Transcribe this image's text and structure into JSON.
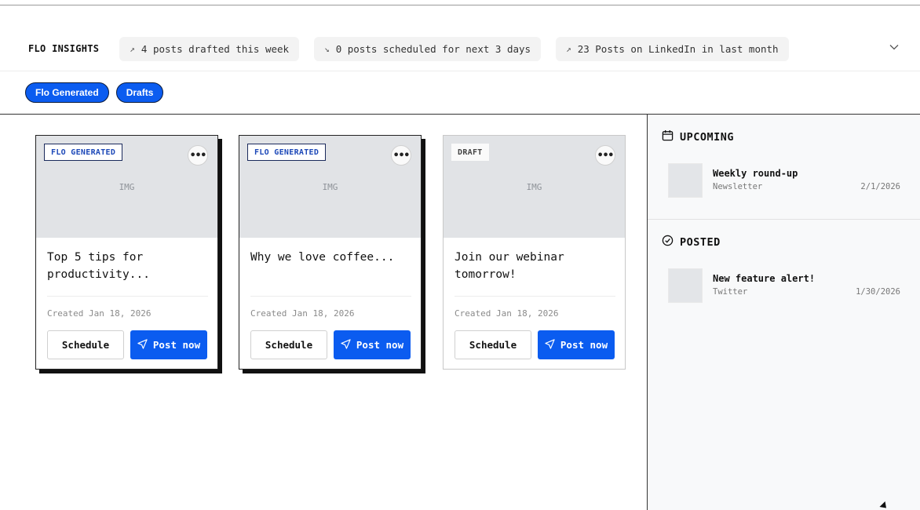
{
  "insights": {
    "title": "FLO INSIGHTS",
    "pills": [
      {
        "trend_icon": "trend-up-icon",
        "text": "4 posts drafted this week"
      },
      {
        "trend_icon": "trend-down-icon",
        "text": "0 posts scheduled for next 3 days"
      },
      {
        "trend_icon": "trend-up-icon",
        "text": "23 Posts on LinkedIn in last month"
      }
    ]
  },
  "filters": [
    "Flo Generated",
    "Drafts"
  ],
  "cards": [
    {
      "tag": "FLO GENERATED",
      "media": "IMG",
      "title": "Top 5 tips for productivity...",
      "created": "Created Jan 18, 2026",
      "schedule_label": "Schedule",
      "post_label": "Post now"
    },
    {
      "tag": "FLO GENERATED",
      "media": "IMG",
      "title": "Why we love coffee...",
      "created": "Created Jan 18, 2026",
      "schedule_label": "Schedule",
      "post_label": "Post now"
    },
    {
      "tag": "DRAFT",
      "media": "IMG",
      "title": "Join our webinar tomorrow!",
      "created": "Created Jan 18, 2026",
      "schedule_label": "Schedule",
      "post_label": "Post now"
    }
  ],
  "sidebar": {
    "upcoming": {
      "heading": "UPCOMING",
      "items": [
        {
          "name": "Weekly round-up",
          "channel": "Newsletter",
          "date": "2/1/2026"
        }
      ]
    },
    "posted": {
      "heading": "POSTED",
      "items": [
        {
          "name": "New feature alert!",
          "channel": "Twitter",
          "date": "1/30/2026"
        }
      ]
    }
  },
  "colors": {
    "accent": "#0b5cf0",
    "tag_text": "#1c48b8",
    "sidebar_bg": "#f8f9fa"
  }
}
